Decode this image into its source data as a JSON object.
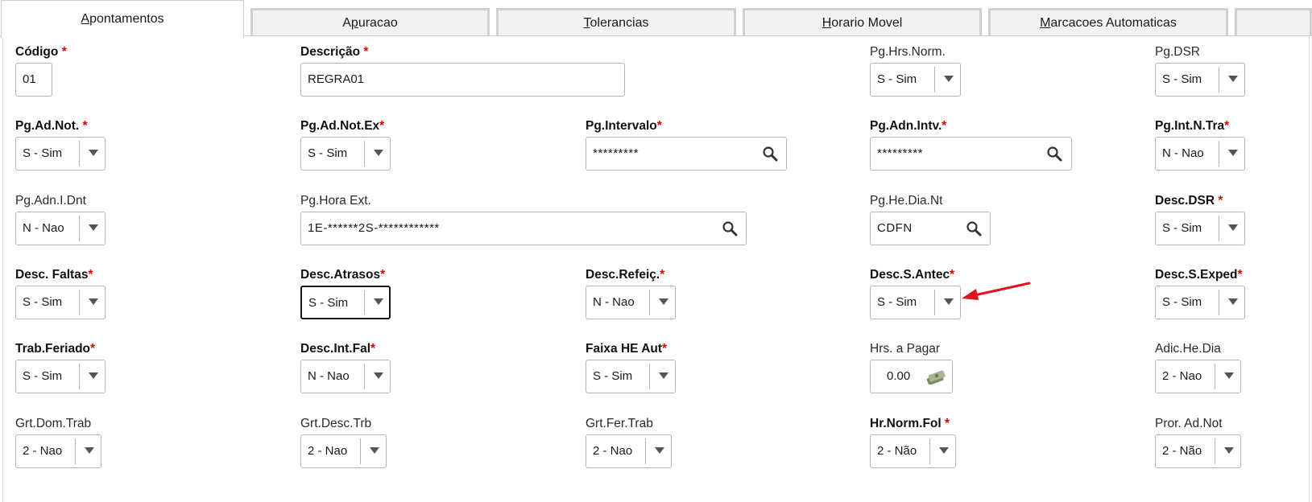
{
  "tabs": [
    {
      "pre": "",
      "acc": "A",
      "post": "pontamentos"
    },
    {
      "pre": "A",
      "acc": "p",
      "post": "uracao"
    },
    {
      "pre": "",
      "acc": "T",
      "post": "olerancias"
    },
    {
      "pre": "",
      "acc": "H",
      "post": "orario Movel"
    },
    {
      "pre": "",
      "acc": "M",
      "post": "arcacoes Automaticas"
    }
  ],
  "required_mark": "*",
  "fields": {
    "codigo": {
      "label": "Código",
      "value": "01"
    },
    "descricao": {
      "label": "Descrição",
      "value": "REGRA01"
    },
    "pg_hrs_norm": {
      "label": "Pg.Hrs.Norm.",
      "value": "S - Sim"
    },
    "pg_dsr": {
      "label": "Pg.DSR",
      "value": "S - Sim"
    },
    "pg_ad_not": {
      "label": "Pg.Ad.Not.",
      "value": "S - Sim"
    },
    "pg_ad_not_ex": {
      "label": "Pg.Ad.Not.Ex",
      "value": "S - Sim"
    },
    "pg_intervalo": {
      "label": "Pg.Intervalo",
      "value": "*********"
    },
    "pg_adn_intv": {
      "label": "Pg.Adn.Intv.",
      "value": "*********"
    },
    "pg_int_n_tra": {
      "label": "Pg.Int.N.Tra",
      "value": "N - Nao"
    },
    "pg_adn_i_dnt": {
      "label": "Pg.Adn.I.Dnt",
      "value": "N - Nao"
    },
    "pg_hora_ext": {
      "label": "Pg.Hora Ext.",
      "value": "1E-******2S-************"
    },
    "pg_he_dia_nt": {
      "label": "Pg.He.Dia.Nt",
      "value": "CDFN"
    },
    "desc_dsr": {
      "label": "Desc.DSR",
      "value": "S - Sim"
    },
    "desc_faltas": {
      "label": "Desc. Faltas",
      "value": "S - Sim"
    },
    "desc_atrasos": {
      "label": "Desc.Atrasos",
      "value": "S - Sim"
    },
    "desc_refeic": {
      "label": "Desc.Refeiç.",
      "value": "N - Nao"
    },
    "desc_s_antec": {
      "label": "Desc.S.Antec",
      "value": "S - Sim"
    },
    "desc_s_exped": {
      "label": "Desc.S.Exped",
      "value": "S - Sim"
    },
    "trab_feriado": {
      "label": "Trab.Feriado",
      "value": "S - Sim"
    },
    "desc_int_fal": {
      "label": "Desc.Int.Fal",
      "value": "N - Nao"
    },
    "faixa_he_aut": {
      "label": "Faixa HE Aut",
      "value": "S - Sim"
    },
    "hrs_a_pagar": {
      "label": "Hrs. a Pagar",
      "value": "0.00"
    },
    "adic_he_dia": {
      "label": "Adic.He.Dia",
      "value": "2 - Nao"
    },
    "grt_dom_trab": {
      "label": "Grt.Dom.Trab",
      "value": "2 - Nao"
    },
    "grt_desc_trb": {
      "label": "Grt.Desc.Trb",
      "value": "2 - Nao"
    },
    "grt_fer_trab": {
      "label": "Grt.Fer.Trab",
      "value": "2 - Nao"
    },
    "hr_norm_fol": {
      "label": "Hr.Norm.Fol",
      "value": "2 - Não"
    },
    "pror_ad_not": {
      "label": "Pror. Ad.Not",
      "value": "2 - Não"
    }
  },
  "colors": {
    "required": "#e00000",
    "focus_border": "#0f1c2a",
    "annotation_arrow": "#e0141b"
  },
  "icons": {
    "search": "magnifier-icon",
    "currency": "money-icon",
    "dropdown": "chevron-down-icon",
    "annotation": "red-arrow-icon"
  }
}
